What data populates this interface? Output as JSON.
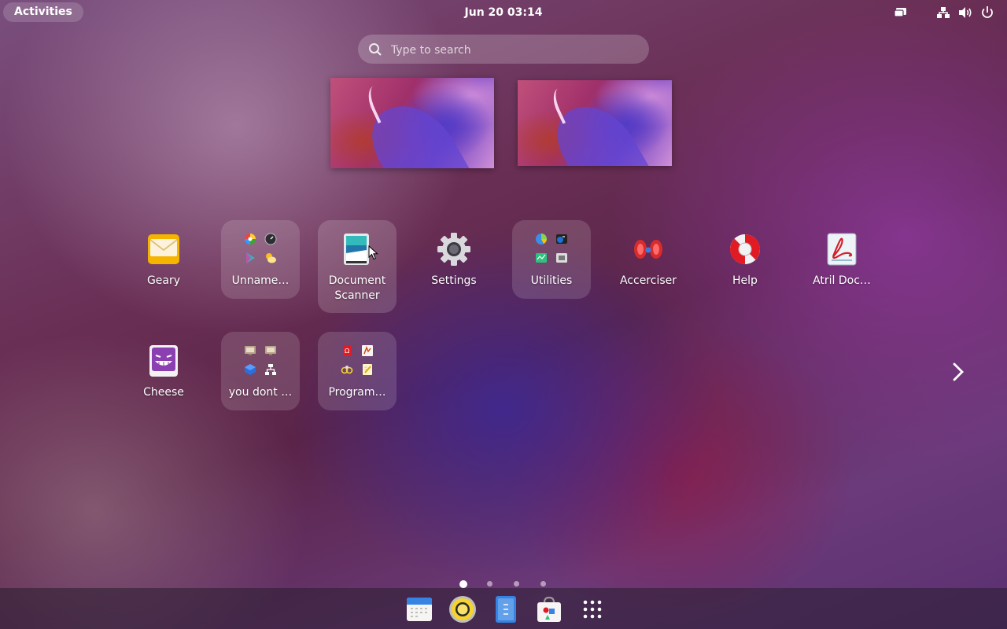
{
  "topbar": {
    "activities_label": "Activities",
    "clock": "Jun 20  03:14",
    "tray_icons": [
      "screen-share-icon",
      "network-icon",
      "volume-icon",
      "power-icon"
    ]
  },
  "search": {
    "placeholder": "Type to search",
    "value": ""
  },
  "workspaces": {
    "count": 2
  },
  "apps": [
    {
      "label": "Geary",
      "icon": "mail-icon"
    },
    {
      "label": "Unname…",
      "icon": "folder",
      "folder": true
    },
    {
      "label": "Document\nScanner",
      "icon": "scanner-icon"
    },
    {
      "label": "Settings",
      "icon": "gear-icon"
    },
    {
      "label": "Utilities",
      "icon": "folder",
      "folder": true
    },
    {
      "label": "Accerciser",
      "icon": "dumbbell-icon"
    },
    {
      "label": "Help",
      "icon": "lifebuoy-icon"
    },
    {
      "label": "Atril Doc…",
      "icon": "pdf-icon"
    },
    {
      "label": "Cheese",
      "icon": "cheese-icon"
    },
    {
      "label": "you dont …",
      "icon": "folder",
      "folder": true
    },
    {
      "label": "Program…",
      "icon": "folder",
      "folder": true
    }
  ],
  "pagination": {
    "pages": 4,
    "current": 1
  },
  "dash": [
    "calendar-icon",
    "rhythmbox-icon",
    "text-editor-icon",
    "software-center-icon",
    "show-apps-icon"
  ],
  "colors": {
    "accent": "#ffffff",
    "folder_bg": "rgba(255,255,255,0.14)"
  }
}
